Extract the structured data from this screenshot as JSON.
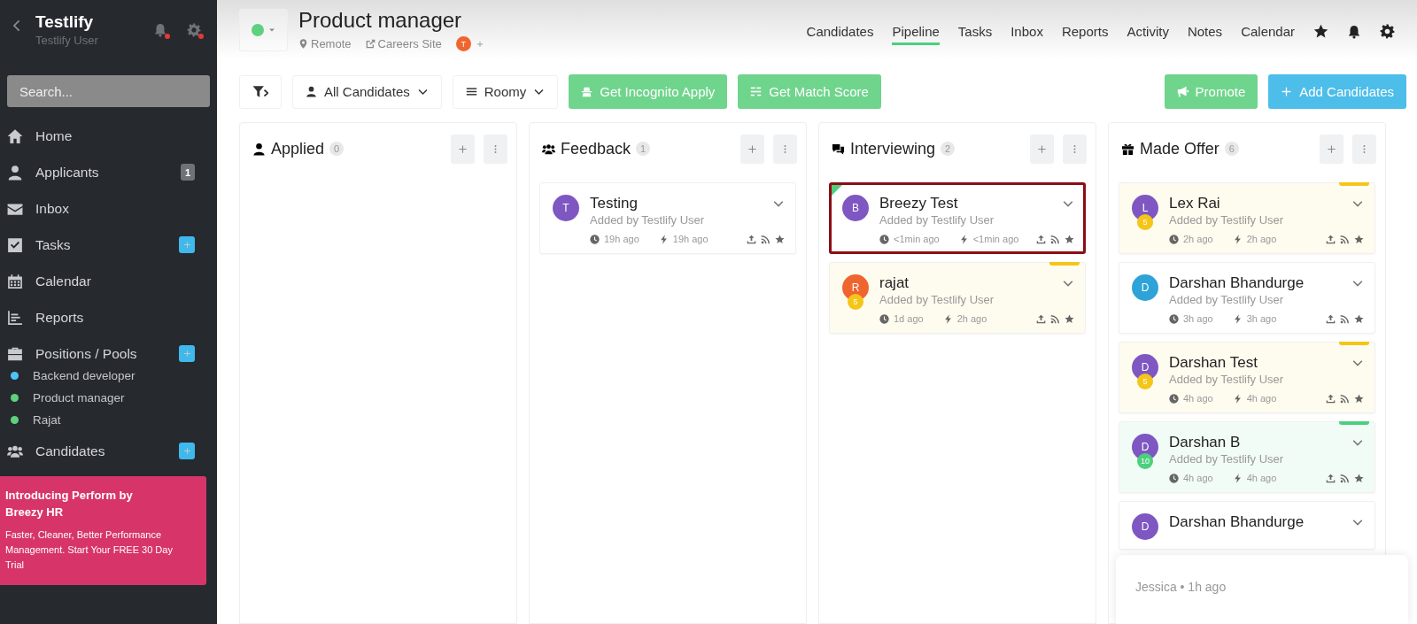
{
  "sidebar": {
    "title": "Testlify",
    "subtitle": "Testlify User",
    "search": {
      "placeholder": "Search..."
    },
    "items": [
      {
        "label": "Home",
        "add": false
      },
      {
        "label": "Applicants",
        "badge": "1",
        "add": false
      },
      {
        "label": "Inbox",
        "add": false
      },
      {
        "label": "Tasks",
        "add": true
      },
      {
        "label": "Calendar",
        "add": false
      },
      {
        "label": "Reports",
        "add": false
      },
      {
        "label": "Positions / Pools",
        "add": true,
        "children": [
          {
            "label": "Backend developer",
            "color": "#4fc3f7"
          },
          {
            "label": "Product manager",
            "color": "#5ed17f"
          },
          {
            "label": "Rajat",
            "color": "#5ed17f"
          }
        ]
      },
      {
        "label": "Candidates",
        "add": true
      }
    ],
    "promo": {
      "title": "Introducing Perform by Breezy HR",
      "text": "Faster, Cleaner, Better Performance Management. Start Your FREE 30 Day Trial"
    }
  },
  "header": {
    "title": "Product manager",
    "location": "Remote",
    "link": "Careers Site",
    "member": "T",
    "tabs": [
      {
        "label": "Candidates",
        "selected": false
      },
      {
        "label": "Pipeline",
        "selected": true
      },
      {
        "label": "Tasks",
        "selected": false
      },
      {
        "label": "Inbox",
        "selected": false
      },
      {
        "label": "Reports",
        "selected": false
      },
      {
        "label": "Activity",
        "selected": false
      },
      {
        "label": "Notes",
        "selected": false
      },
      {
        "label": "Calendar",
        "selected": false
      }
    ]
  },
  "toolbar": {
    "filter": "All Candidates",
    "view": "Roomy",
    "buttons": [
      {
        "label": "Get Incognito Apply",
        "kind": "green"
      },
      {
        "label": "Get Match Score",
        "kind": "green"
      }
    ],
    "right_buttons": [
      {
        "label": "Promote",
        "kind": "green"
      },
      {
        "label": "Add Candidates",
        "kind": "blue"
      }
    ]
  },
  "columns": [
    {
      "title": "Applied",
      "count": "0"
    },
    {
      "title": "Feedback",
      "count": "1",
      "cards": [
        {
          "initial": "T",
          "color": "#7e57c2",
          "name": "Testing",
          "added": "Added by Testlify User",
          "updated": "19h ago",
          "activity": "19h ago",
          "highlighted": false,
          "new": false
        }
      ]
    },
    {
      "title": "Interviewing",
      "count": "2",
      "cards": [
        {
          "initial": "B",
          "color": "#7e57c2",
          "name": "Breezy Test",
          "added": "Added by Testlify User",
          "updated": "<1min ago",
          "activity": "<1min ago",
          "highlighted": true,
          "new": true
        },
        {
          "initial": "R",
          "color": "#ef6530",
          "name": "rajat",
          "added": "Added by Testlify User",
          "updated": "1d ago",
          "activity": "2h ago",
          "highlighted": false,
          "new": false,
          "score": {
            "text": "5",
            "color": "#f5c518"
          }
        }
      ]
    },
    {
      "title": "Made Offer",
      "count": "6",
      "cards": [
        {
          "initial": "L",
          "color": "#7e57c2",
          "name": "Lex Rai",
          "added": "Added by Testlify User",
          "updated": "2h ago",
          "activity": "2h ago",
          "highlighted": false,
          "new": false,
          "score": {
            "text": "5",
            "color": "#f5c518"
          }
        },
        {
          "initial": "D",
          "color": "#2ea3d8",
          "name": "Darshan Bhandurge",
          "added": "Added by Testlify User",
          "updated": "3h ago",
          "activity": "3h ago",
          "highlighted": false,
          "new": false
        },
        {
          "initial": "D",
          "color": "#7e57c2",
          "name": "Darshan Test",
          "added": "Added by Testlify User",
          "updated": "4h ago",
          "activity": "4h ago",
          "highlighted": false,
          "new": false,
          "score": {
            "text": "5",
            "color": "#f5c518"
          }
        },
        {
          "initial": "D",
          "color": "#7e57c2",
          "name": "Darshan B",
          "added": "Added by Testlify User",
          "updated": "4h ago",
          "activity": "4h ago",
          "highlighted": false,
          "new": false,
          "score": {
            "text": "10",
            "color": "#4cd07d"
          }
        },
        {
          "initial": "D",
          "color": "#7e57c2",
          "name": "Darshan Bhandurge",
          "highlighted": false,
          "new": false
        }
      ]
    }
  ],
  "notification": {
    "text": "Jessica • 1h ago"
  }
}
